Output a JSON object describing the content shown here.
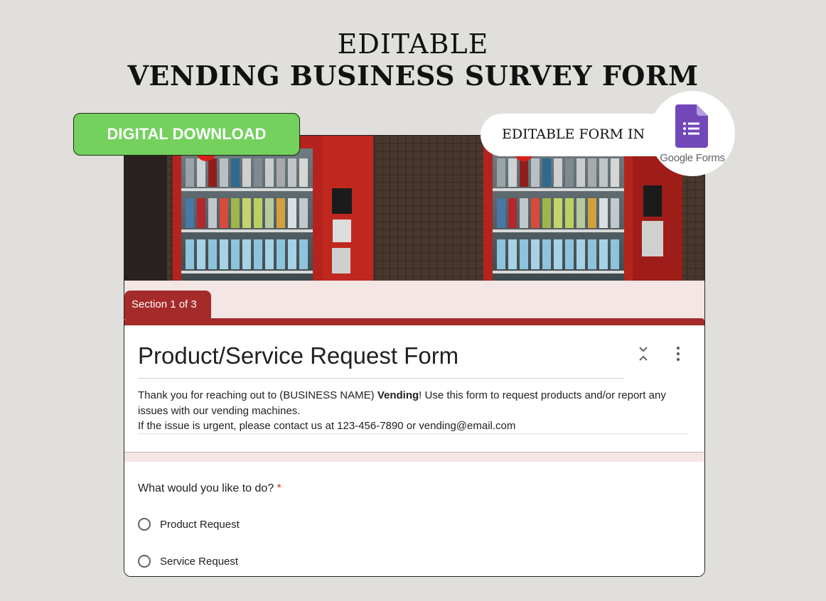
{
  "header": {
    "line1": "EDITABLE",
    "line2": "VENDING BUSINESS SURVEY FORM"
  },
  "badge": {
    "download_label": "DIGITAL DOWNLOAD"
  },
  "editable_pill": {
    "text": "EDITABLE FORM IN",
    "logo_label": "Google Forms",
    "logo_icon": "google-forms-icon"
  },
  "form": {
    "section_tab": "Section 1 of 3",
    "title": "Product/Service Request Form",
    "description": {
      "part1": "Thank you for reaching out to (BUSINESS NAME) ",
      "bold": "Vending",
      "part2": "! Use this form to request products and/or report any issues with our vending machines.",
      "line2": "If the issue is urgent, please contact us at 123-456-7890 or vending@email.com"
    },
    "question": {
      "text": "What would you like to do?",
      "required_mark": "*",
      "options": [
        "Product Request",
        "Service Request"
      ]
    },
    "icons": [
      "collapse-icon",
      "more-vert-icon",
      "radio-unchecked-icon"
    ]
  },
  "colors": {
    "background": "#e0dfdb",
    "accent_red": "#a52a2a",
    "download_green": "#74d15e",
    "forms_purple": "#7248b9",
    "required_red": "#d93025"
  }
}
